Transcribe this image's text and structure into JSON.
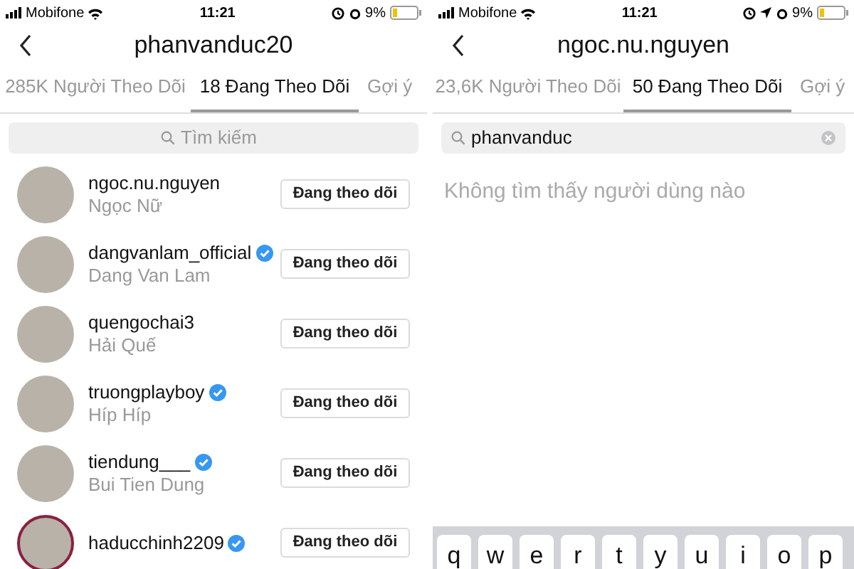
{
  "panes": [
    {
      "status_bar": {
        "carrier": "Mobifone",
        "time": "11:21",
        "battery": "9%",
        "location": false
      },
      "title": "phanvanduc20",
      "tabs": [
        {
          "label": "285K Người Theo Dõi",
          "selected": false
        },
        {
          "label": "18 Đang Theo Dõi",
          "selected": true
        },
        {
          "label": "Gợi ý",
          "selected": false
        }
      ],
      "search": {
        "placeholder": "Tìm kiếm"
      },
      "users": [
        {
          "username": "ngoc.nu.nguyen",
          "name": "Ngọc Nữ",
          "verified": false,
          "story_ring": false,
          "button": "Đang theo dõi"
        },
        {
          "username": "dangvanlam_official",
          "name": "Dang Van Lam",
          "verified": true,
          "story_ring": false,
          "button": "Đang theo dõi"
        },
        {
          "username": "quengochai3",
          "name": "Hải Quế",
          "verified": false,
          "story_ring": false,
          "button": "Đang theo dõi"
        },
        {
          "username": "truongplayboy",
          "name": "Híp Híp",
          "verified": true,
          "story_ring": false,
          "button": "Đang theo dõi"
        },
        {
          "username": "tiendung___",
          "name": "Bui Tien Dung",
          "verified": true,
          "story_ring": false,
          "button": "Đang theo dõi"
        },
        {
          "username": "haducchinh2209",
          "verified": true,
          "story_ring": true,
          "button": "Đang theo dõi"
        }
      ]
    },
    {
      "status_bar": {
        "carrier": "Mobifone",
        "time": "11:21",
        "battery": "9%",
        "location": true
      },
      "title": "ngoc.nu.nguyen",
      "tabs": [
        {
          "label": "23,6K Người Theo Dõi",
          "selected": false
        },
        {
          "label": "50 Đang Theo Dõi",
          "selected": true
        },
        {
          "label": "Gợi ý",
          "selected": false
        }
      ],
      "search": {
        "value": "phanvanduc"
      },
      "empty_message": "Không tìm thấy người dùng nào",
      "keyboard": [
        "q",
        "w",
        "e",
        "r",
        "t",
        "y",
        "u",
        "i",
        "o",
        "p"
      ]
    }
  ]
}
